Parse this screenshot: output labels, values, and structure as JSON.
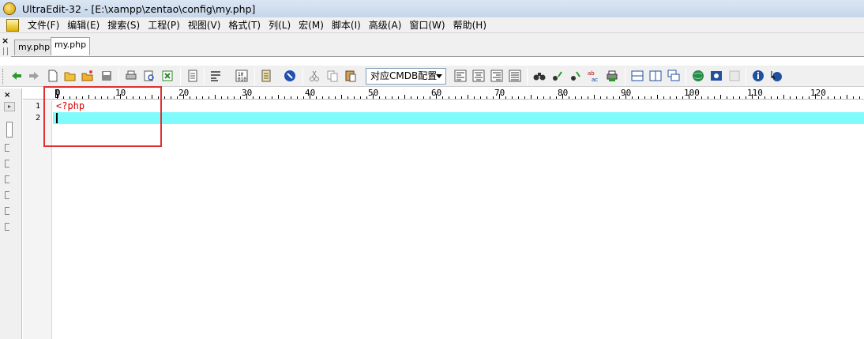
{
  "window": {
    "title": "UltraEdit-32 - [E:\\xampp\\zentao\\config\\my.php]"
  },
  "menu": [
    "文件(F)",
    "编辑(E)",
    "搜索(S)",
    "工程(P)",
    "视图(V)",
    "格式(T)",
    "列(L)",
    "宏(M)",
    "脚本(I)",
    "高级(A)",
    "窗口(W)",
    "帮助(H)"
  ],
  "tabs": [
    {
      "label": "my.php",
      "active": false
    },
    {
      "label": "my.php",
      "active": true
    }
  ],
  "toolbar": {
    "codepage_combo": "对应CMDB配置"
  },
  "ruler": {
    "labels": [
      "0",
      "10",
      "20",
      "30",
      "40",
      "50",
      "60",
      "70",
      "80",
      "90",
      "100",
      "110",
      "120"
    ]
  },
  "editor": {
    "lines": [
      {
        "number": "1",
        "text": "<?php"
      },
      {
        "number": "2",
        "text": ""
      }
    ],
    "current_line_color": "#7ffbfb",
    "php_tag_color": "#d40000"
  },
  "annotation": {
    "highlight_color": "#e03030"
  }
}
